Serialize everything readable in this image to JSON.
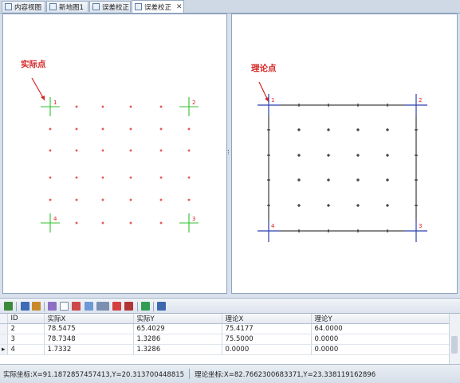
{
  "tabs": [
    {
      "label": "内容视图",
      "active": false
    },
    {
      "label": "新地图1",
      "active": false
    },
    {
      "label": "误差校正",
      "active": false
    },
    {
      "label": "误差校正",
      "active": true,
      "closable": true,
      "close_glyph": "✕"
    }
  ],
  "left_view": {
    "callout": "实际点",
    "point_labels": [
      "1",
      "2",
      "3",
      "4"
    ]
  },
  "right_view": {
    "callout": "理论点",
    "point_labels": [
      "1",
      "2",
      "3",
      "4"
    ]
  },
  "colors": {
    "actual_marker": "#2fbf2f",
    "actual_point": "#e02020",
    "theory_marker": "#2b3fae",
    "callout": "#d42424"
  },
  "toolbar_icons": [
    "add-icon",
    "save-icon",
    "export-icon",
    "wand-icon",
    "add-point-icon",
    "edit-icon",
    "edit-all-icon",
    "calculate-icon",
    "delete-icon",
    "delete-all-icon",
    "transform-icon",
    "options-icon"
  ],
  "table": {
    "columns": [
      "ID",
      "实际X",
      "实际Y",
      "理论X",
      "理论Y"
    ],
    "rows": [
      {
        "id": "2",
        "ax": "78.5475",
        "ay": "65.4029",
        "tx": "75.4177",
        "ty": "64.0000",
        "current": false
      },
      {
        "id": "3",
        "ax": "78.7348",
        "ay": "1.3286",
        "tx": "75.5000",
        "ty": "0.0000",
        "current": false
      },
      {
        "id": "4",
        "ax": "1.7332",
        "ay": "1.3286",
        "tx": "0.0000",
        "ty": "0.0000",
        "current": true
      }
    ],
    "current_row_marker": "▸"
  },
  "status": {
    "actual": "实际坐标:X=91.1872857457413,Y=20.313700448815",
    "theory": "理论坐标:X=82.7662300683371,Y=23.338119162896"
  }
}
